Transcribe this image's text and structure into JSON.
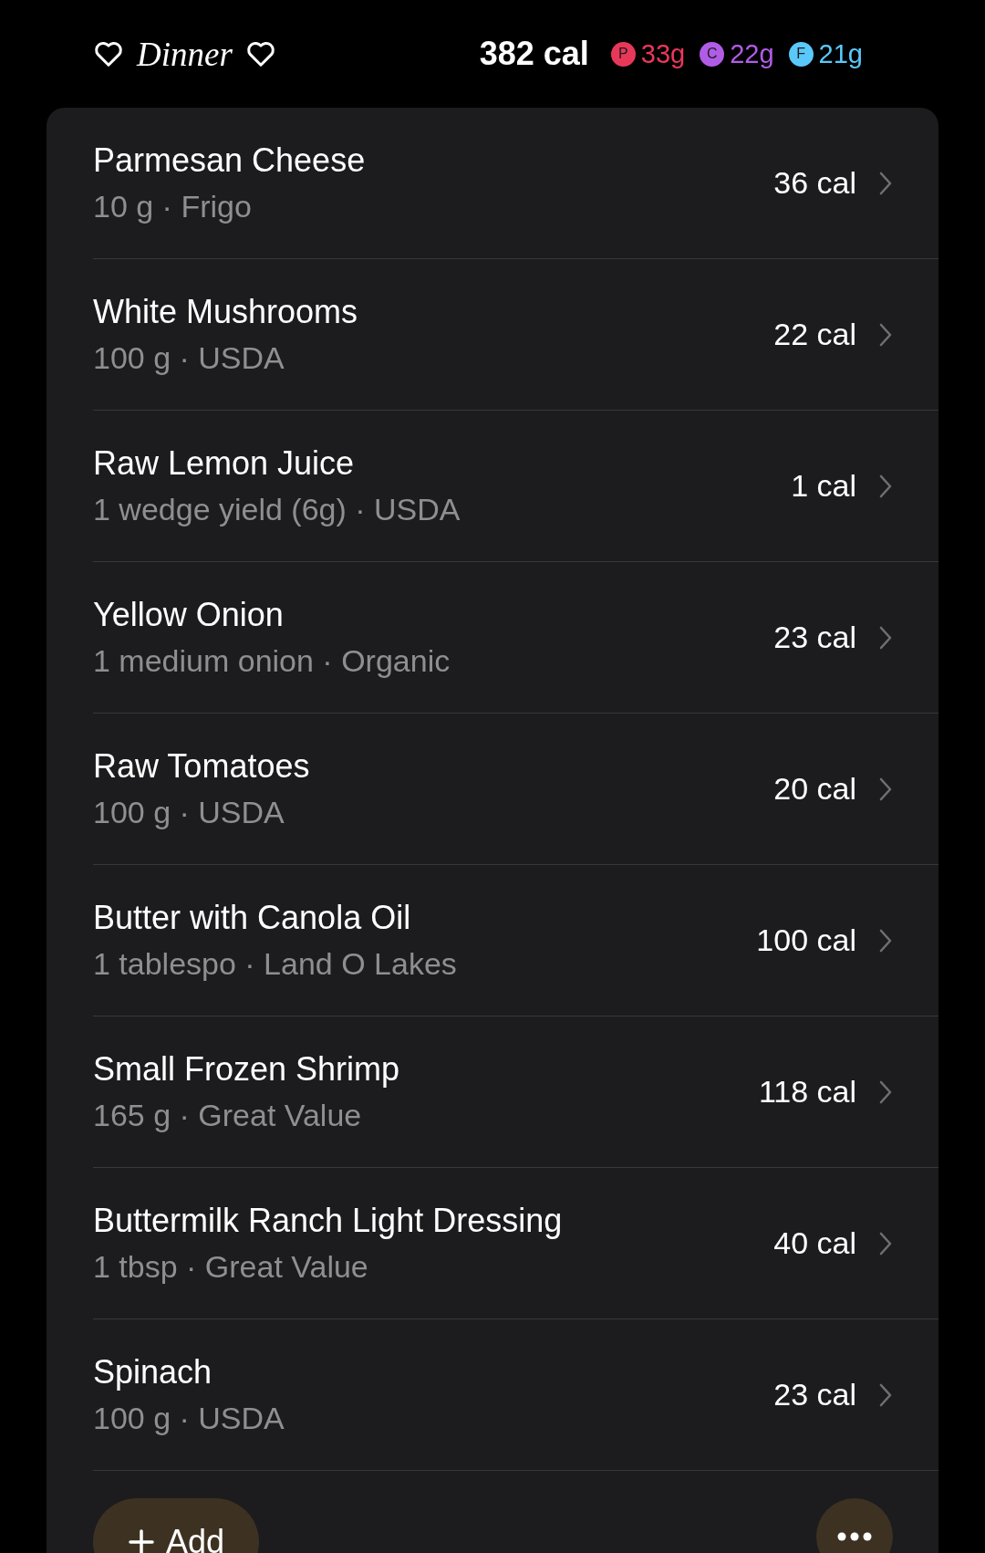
{
  "header": {
    "title": "Dinner",
    "calories": "382 cal",
    "macros": [
      {
        "letter": "P",
        "amount": "33g",
        "color": "#e8385a"
      },
      {
        "letter": "C",
        "amount": "22g",
        "color": "#b15ce6"
      },
      {
        "letter": "F",
        "amount": "21g",
        "color": "#5ac8fa"
      }
    ]
  },
  "items": [
    {
      "name": "Parmesan Cheese",
      "detail": "10 g · Frigo",
      "calories": "36 cal"
    },
    {
      "name": "White Mushrooms",
      "detail": "100 g · USDA",
      "calories": "22 cal"
    },
    {
      "name": "Raw Lemon Juice",
      "detail": "1 wedge yield (6g) · USDA",
      "calories": "1 cal"
    },
    {
      "name": "Yellow Onion",
      "detail": "1 medium onion · Organic",
      "calories": "23 cal"
    },
    {
      "name": "Raw Tomatoes",
      "detail": "100 g · USDA",
      "calories": "20 cal"
    },
    {
      "name": "Butter with Canola Oil",
      "detail": "1 tablespo · Land O Lakes",
      "calories": "100 cal"
    },
    {
      "name": "Small Frozen Shrimp",
      "detail": "165 g · Great Value",
      "calories": "118 cal"
    },
    {
      "name": "Buttermilk Ranch Light Dressing",
      "detail": "1 tbsp · Great Value",
      "calories": "40 cal"
    },
    {
      "name": "Spinach",
      "detail": "100 g · USDA",
      "calories": "23 cal"
    }
  ],
  "add_button": {
    "label": "Add"
  }
}
